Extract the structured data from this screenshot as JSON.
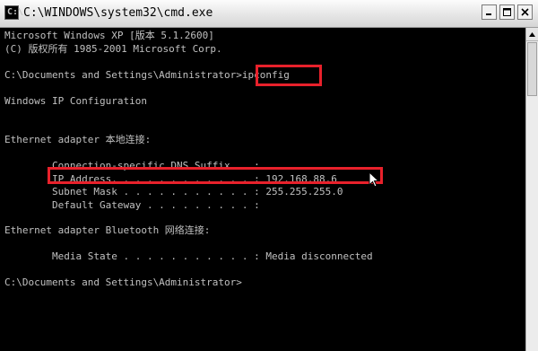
{
  "window": {
    "title": "C:\\WINDOWS\\system32\\cmd.exe",
    "icon": "cmd-prompt-icon",
    "app_icon_glyph": "C:\\",
    "buttons": [
      "minimize-icon",
      "maximize-icon",
      "close-icon"
    ]
  },
  "console": {
    "line_1": "Microsoft Windows XP [版本 5.1.2600]",
    "line_2": "(C) 版权所有 1985-2001 Microsoft Corp.",
    "prompt_1": "C:\\Documents and Settings\\Administrator>",
    "command": "ipconfig",
    "header": "Windows IP Configuration",
    "adapter_1": "Ethernet adapter 本地连接:",
    "dns_suffix": "        Connection-specific DNS Suffix  . :",
    "ip_address": "        IP Address. . . . . . . . . . . . : 192.168.88.6",
    "subnet_mask": "        Subnet Mask . . . . . . . . . . . : 255.255.255.0",
    "default_gateway": "        Default Gateway . . . . . . . . . :",
    "adapter_2": "Ethernet adapter Bluetooth 网络连接:",
    "media_state": "        Media State . . . . . . . . . . . : Media disconnected",
    "prompt_2": "C:\\Documents and Settings\\Administrator>"
  },
  "colors": {
    "console_bg": "#000000",
    "console_fg": "#c0c0c0",
    "highlight": "#e8212b"
  }
}
